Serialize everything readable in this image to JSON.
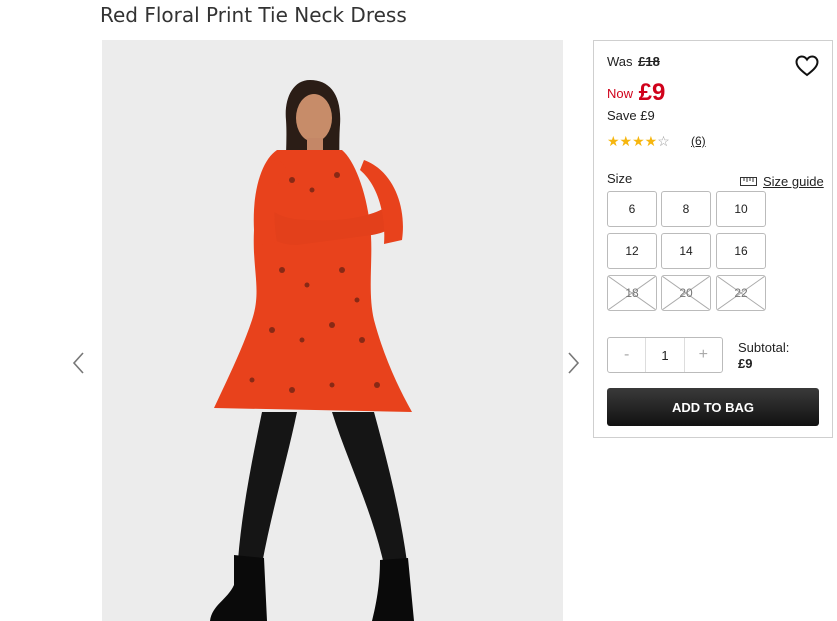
{
  "product": {
    "title": "Red Floral Print Tie Neck Dress"
  },
  "pricing": {
    "was_label": "Was",
    "was_price": "£18",
    "now_label": "Now",
    "now_price": "£9",
    "save_label": "Save",
    "save_amount": "£9",
    "currency_color": "#d0021b"
  },
  "rating": {
    "stars_filled": 4,
    "stars_total": 5,
    "filled_glyph": "★★★★",
    "empty_glyph": "☆",
    "review_count": "(6)"
  },
  "size": {
    "label": "Size",
    "guide_label": "Size guide",
    "options": [
      {
        "label": "6",
        "available": true
      },
      {
        "label": "8",
        "available": true
      },
      {
        "label": "10",
        "available": true
      },
      {
        "label": "12",
        "available": true
      },
      {
        "label": "14",
        "available": true
      },
      {
        "label": "16",
        "available": true
      },
      {
        "label": "18",
        "available": false
      },
      {
        "label": "20",
        "available": false
      },
      {
        "label": "22",
        "available": false
      }
    ]
  },
  "quantity": {
    "minus": "-",
    "value": "1",
    "plus": "+"
  },
  "subtotal": {
    "label": "Subtotal:",
    "amount": "£9"
  },
  "actions": {
    "add_to_bag": "ADD TO BAG"
  },
  "icons": {
    "prev": "chevron-left-icon",
    "next": "chevron-right-icon",
    "wishlist": "heart-icon",
    "size_guide": "ruler-icon"
  }
}
